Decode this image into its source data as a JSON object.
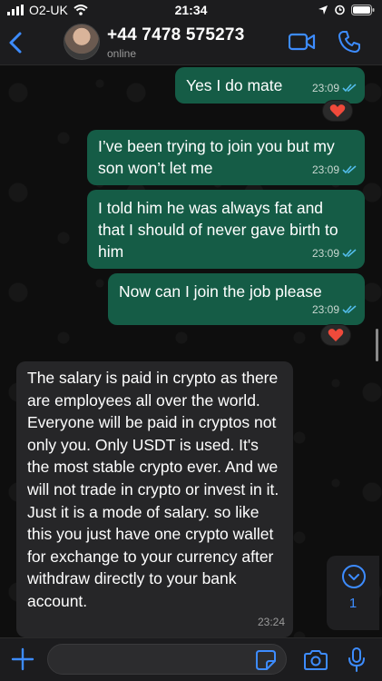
{
  "status_bar": {
    "carrier": "O2-UK",
    "time": "21:34"
  },
  "header": {
    "contact_name": "+44 7478 575273",
    "status": "online"
  },
  "messages": [
    {
      "text": "Yes I do mate",
      "time": "23:09"
    },
    {
      "text": "I’ve been trying to join you but my son won’t let me",
      "time": "23:09"
    },
    {
      "text": "I told him he was always fat and that I should of never gave birth to him",
      "time": "23:09"
    },
    {
      "text": "Now can I join the job please",
      "time": "23:09"
    },
    {
      "text": "The salary is paid in crypto as there are employees all over the world. Everyone will be paid in cryptos not only you. Only USDT is used. It's the most stable crypto ever. And we will not trade in crypto or invest in it. Just it is a mode of salary. so like this you just have one crypto wallet for exchange to your currency after withdraw directly to your bank account.",
      "time": "23:24"
    }
  ],
  "reactions": [
    {
      "emoji": "❤️"
    },
    {
      "emoji": "❤️"
    }
  ],
  "scroll_down": {
    "unread_count": "1"
  },
  "colors": {
    "accent": "#3d8cff",
    "outgoing_bubble": "#155c46",
    "incoming_bubble": "#262628",
    "read_ticks": "#53bdeb"
  }
}
